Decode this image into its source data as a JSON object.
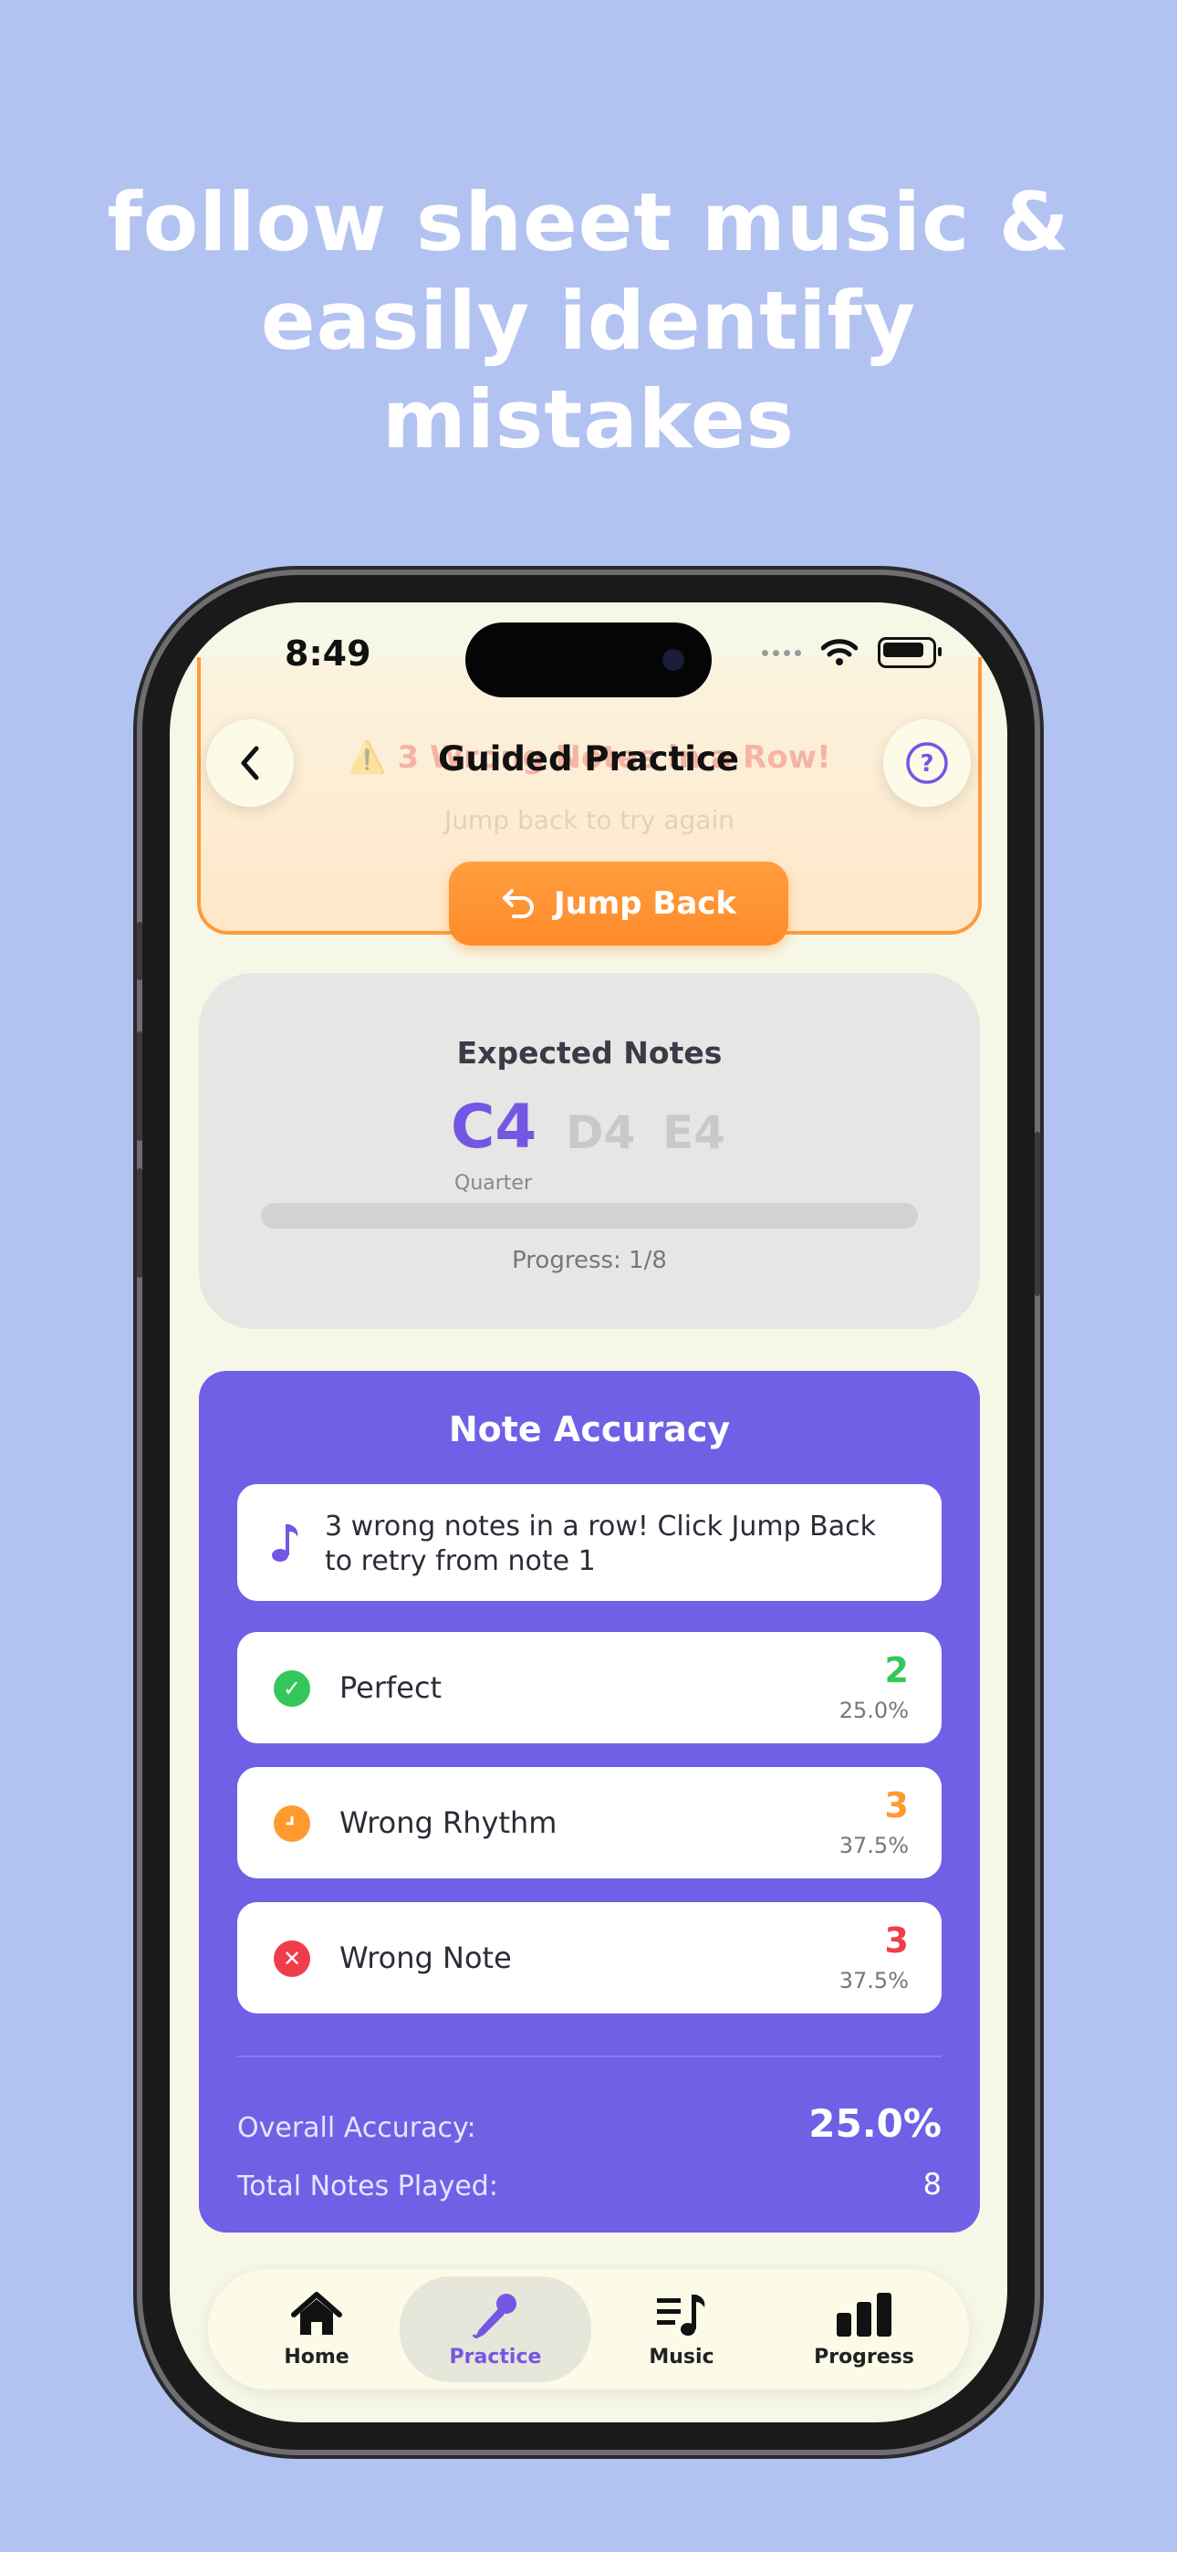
{
  "headline": [
    "follow sheet music &",
    "easily identify",
    "mistakes"
  ],
  "status": {
    "time": "8:49"
  },
  "alert": {
    "title": "⚠️ 3 Wrong Notes in a Row!",
    "subtitle": "Jump back to try again",
    "button_label": "Jump Back"
  },
  "nav": {
    "title": "Guided Practice"
  },
  "expected": {
    "title": "Expected Notes",
    "current_note": "C4",
    "current_duration": "Quarter",
    "next_notes": [
      "D4",
      "E4"
    ],
    "progress_text": "Progress: 1/8",
    "progress_fraction": 0.0
  },
  "accuracy": {
    "title": "Note Accuracy",
    "message": "3 wrong notes in a row! Click Jump Back to retry from note 1",
    "stats": [
      {
        "label": "Perfect",
        "count": "2",
        "percent": "25.0%",
        "color": "#34c759"
      },
      {
        "label": "Wrong Rhythm",
        "count": "3",
        "percent": "37.5%",
        "color": "#ff9a2e"
      },
      {
        "label": "Wrong Note",
        "count": "3",
        "percent": "37.5%",
        "color": "#f03d4a"
      }
    ],
    "overall_label": "Overall Accuracy:",
    "overall_value": "25.0%",
    "total_label": "Total Notes Played:",
    "total_value": "8"
  },
  "tabs": [
    {
      "label": "Home",
      "icon": "house-icon"
    },
    {
      "label": "Practice",
      "icon": "microphone-icon",
      "active": true
    },
    {
      "label": "Music",
      "icon": "music-list-icon"
    },
    {
      "label": "Progress",
      "icon": "bar-chart-icon"
    }
  ],
  "colors": {
    "accent": "#7357e3",
    "background": "#b3c3f1",
    "orange": "#ff8a2a"
  }
}
